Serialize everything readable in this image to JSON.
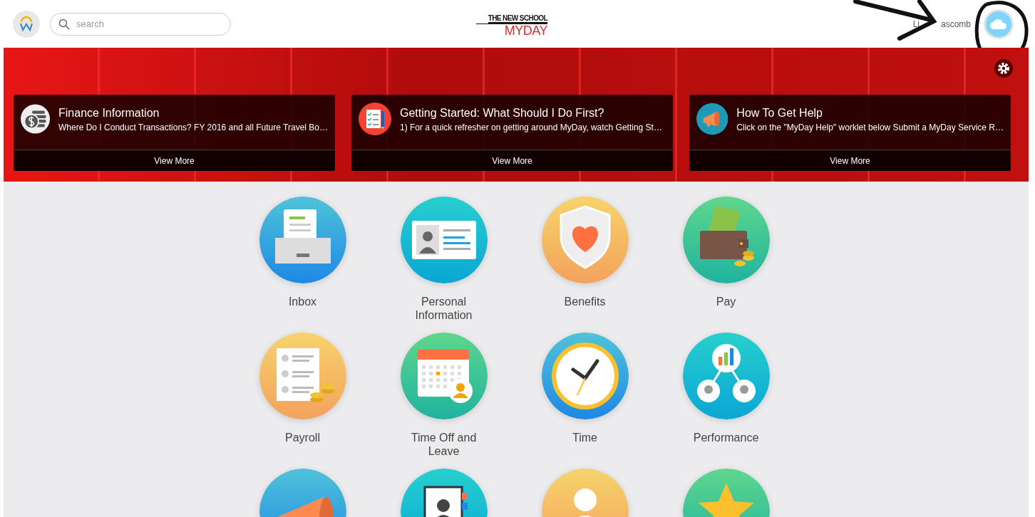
{
  "header": {
    "search": {
      "placeholder": "search"
    },
    "logo": {
      "line_1": "THE NEW SCHOOL",
      "line_2": "MYDAY"
    },
    "user_name_parts": [
      "Li",
      "ascomb"
    ]
  },
  "announcements": [
    {
      "kind": "coins",
      "title": "Finance Information",
      "summary": "Where Do I Conduct Transactions? FY 2016 and all Future Travel Bo…",
      "action": "View More"
    },
    {
      "kind": "checklist",
      "title": "Getting Started: What Should I Do First?",
      "summary": "1) For a quick refresher on getting around MyDay, watch Getting St…",
      "action": "View More"
    },
    {
      "kind": "megaphone",
      "title": "How To Get Help",
      "summary": "Click on the \"MyDay Help\" worklet below Submit a MyDay Service R…",
      "action": "View More"
    }
  ],
  "apps": [
    {
      "kind": "inbox",
      "label": "Inbox"
    },
    {
      "kind": "id-card",
      "label": "Personal Information"
    },
    {
      "kind": "shield",
      "label": "Benefits"
    },
    {
      "kind": "wallet",
      "label": "Pay"
    },
    {
      "kind": "payroll",
      "label": "Payroll"
    },
    {
      "kind": "calendar",
      "label": "Time Off and Leave"
    },
    {
      "kind": "clock",
      "label": "Time"
    },
    {
      "kind": "chart",
      "label": "Performance"
    },
    {
      "kind": "megaphone"
    },
    {
      "kind": "contacts"
    },
    {
      "kind": "person"
    },
    {
      "kind": "star"
    }
  ]
}
